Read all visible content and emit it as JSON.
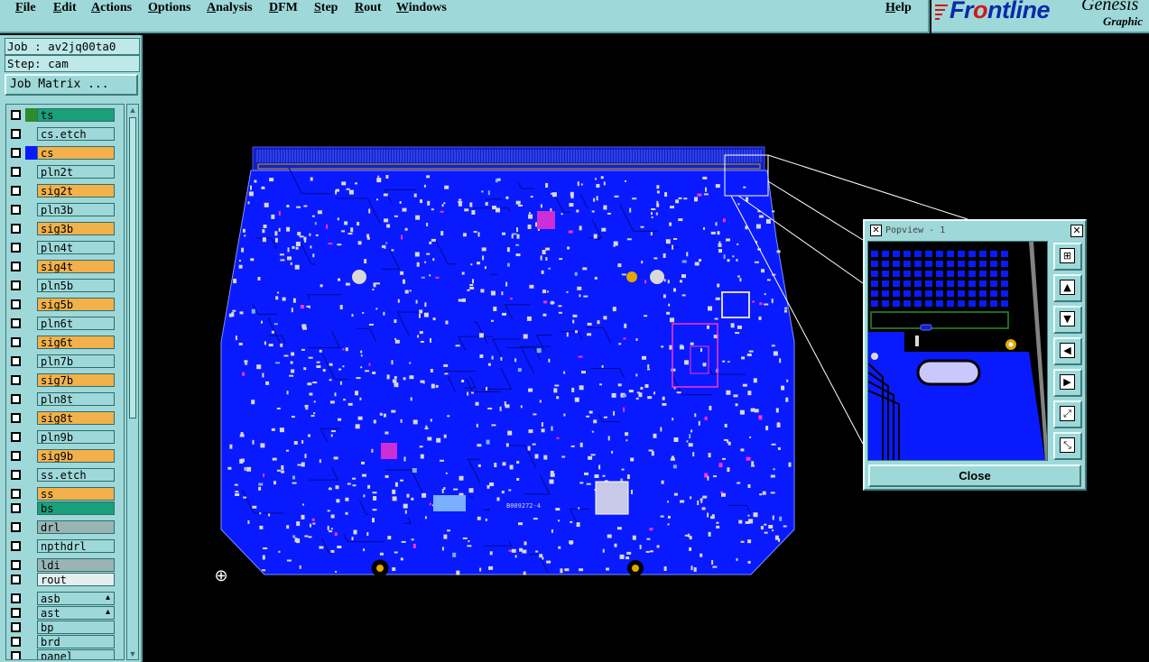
{
  "menu": [
    {
      "id": "file",
      "label": "File"
    },
    {
      "id": "edit",
      "label": "Edit"
    },
    {
      "id": "actions",
      "label": "Actions"
    },
    {
      "id": "options",
      "label": "Options"
    },
    {
      "id": "analysis",
      "label": "Analysis"
    },
    {
      "id": "dfm",
      "label": "DFM"
    },
    {
      "id": "step",
      "label": "Step"
    },
    {
      "id": "rout",
      "label": "Rout"
    },
    {
      "id": "windows",
      "label": "Windows"
    },
    {
      "id": "help",
      "label": "Help"
    }
  ],
  "logo": {
    "brand_before": "Fr",
    "brand_o": "o",
    "brand_after": "ntline",
    "product": "Genesis",
    "tagline": "Graphic"
  },
  "job": {
    "job_line": "Job : av2jq00ta0",
    "step_line": "Step: cam",
    "matrix_button": "Job Matrix ..."
  },
  "layers": [
    {
      "name": "ts",
      "color": "#1aa07a",
      "swatch": "#2d8c2d"
    },
    {
      "name": "cs.etch",
      "color": "#9ed8d8",
      "swatch": ""
    },
    {
      "name": "cs",
      "color": "#f2b14a",
      "swatch": "#0a1aff"
    },
    {
      "name": "pln2t",
      "color": "#9ed8d8",
      "swatch": ""
    },
    {
      "name": "sig2t",
      "color": "#f2b14a",
      "swatch": ""
    },
    {
      "name": "pln3b",
      "color": "#9ed8d8",
      "swatch": ""
    },
    {
      "name": "sig3b",
      "color": "#f2b14a",
      "swatch": ""
    },
    {
      "name": "pln4t",
      "color": "#9ed8d8",
      "swatch": ""
    },
    {
      "name": "sig4t",
      "color": "#f2b14a",
      "swatch": ""
    },
    {
      "name": "pln5b",
      "color": "#9ed8d8",
      "swatch": ""
    },
    {
      "name": "sig5b",
      "color": "#f2b14a",
      "swatch": ""
    },
    {
      "name": "pln6t",
      "color": "#9ed8d8",
      "swatch": ""
    },
    {
      "name": "sig6t",
      "color": "#f2b14a",
      "swatch": ""
    },
    {
      "name": "pln7b",
      "color": "#9ed8d8",
      "swatch": ""
    },
    {
      "name": "sig7b",
      "color": "#f2b14a",
      "swatch": ""
    },
    {
      "name": "pln8t",
      "color": "#9ed8d8",
      "swatch": ""
    },
    {
      "name": "sig8t",
      "color": "#f2b14a",
      "swatch": ""
    },
    {
      "name": "pln9b",
      "color": "#9ed8d8",
      "swatch": ""
    },
    {
      "name": "sig9b",
      "color": "#f2b14a",
      "swatch": ""
    },
    {
      "name": "ss.etch",
      "color": "#9ed8d8",
      "swatch": ""
    },
    {
      "name": "ss",
      "color": "#f2b14a",
      "swatch": ""
    },
    {
      "name": "bs",
      "color": "#1aa07a",
      "swatch": ""
    },
    {
      "name": "drl",
      "color": "#9ab4b4",
      "swatch": ""
    },
    {
      "name": "npthdrl",
      "color": "#9ed8d8",
      "swatch": ""
    },
    {
      "name": "ldi",
      "color": "#9ab4b4",
      "swatch": ""
    },
    {
      "name": "rout",
      "color": "#e4eeee",
      "swatch": ""
    },
    {
      "name": "asb",
      "color": "#9ed8d8",
      "swatch": "",
      "mark": "🔥"
    },
    {
      "name": "ast",
      "color": "#9ed8d8",
      "swatch": "",
      "mark": "🔥"
    },
    {
      "name": "bp",
      "color": "#9ed8d8",
      "swatch": ""
    },
    {
      "name": "brd",
      "color": "#9ed8d8",
      "swatch": ""
    },
    {
      "name": "panel",
      "color": "#9ed8d8",
      "swatch": ""
    }
  ],
  "board_text": "B009272-4",
  "popview": {
    "title": "Popview - 1",
    "close_label": "Close",
    "tools": [
      "zoom-fit-icon",
      "pan-up-icon",
      "pan-down-icon",
      "pan-left-icon",
      "pan-right-icon",
      "zoom-in-icon",
      "zoom-out-icon"
    ]
  },
  "colors": {
    "board": "#0a1aff",
    "panel_bg": "#9ed8d8",
    "pad": "#d8d8d8",
    "copper": "#ff33cc"
  }
}
